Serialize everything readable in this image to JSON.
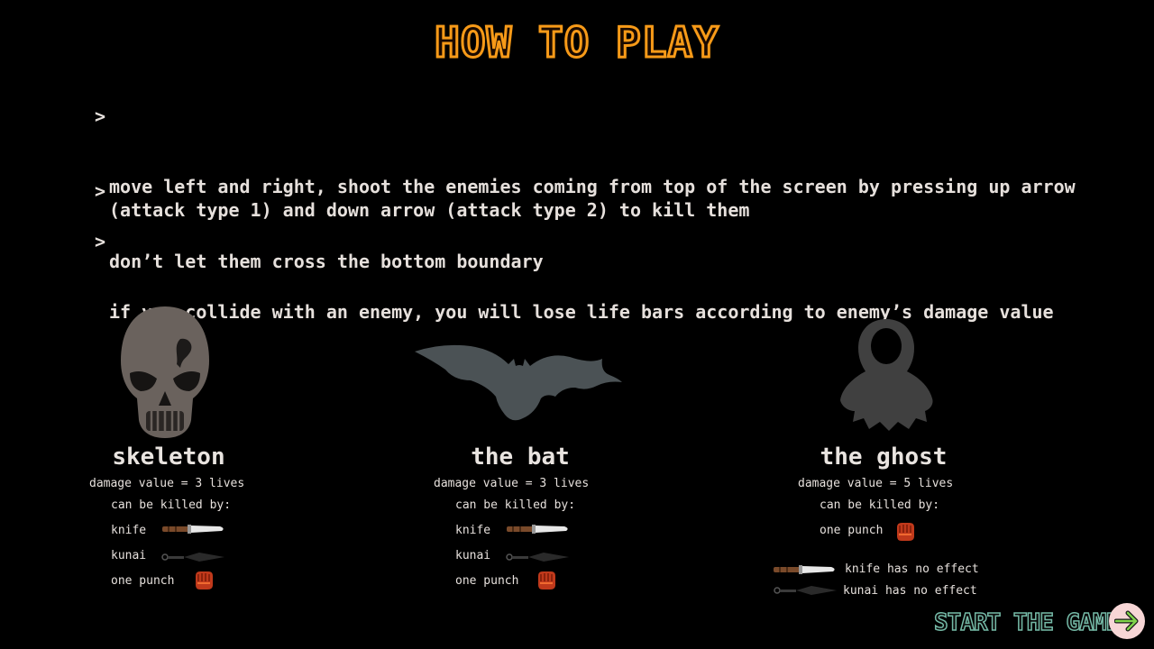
{
  "title": "HOW TO PLAY",
  "rules": [
    {
      "mark": ">",
      "text": "move left and right, shoot the enemies coming from top of the screen by pressing up arrow (attack type 1) and down arrow (attack type 2) to kill them"
    },
    {
      "mark": ">",
      "text": "don’t let them cross the bottom boundary"
    },
    {
      "mark": ">",
      "text": "if you collide with an enemy, you will lose life bars according to enemy’s damage value"
    }
  ],
  "enemies": [
    {
      "name": "skeleton",
      "damage": "damage value = 3 lives",
      "killed_by_label": "can be killed by:",
      "weapons": [
        "knife",
        "kunai",
        "one punch"
      ]
    },
    {
      "name": "the bat",
      "damage": "damage value = 3 lives",
      "killed_by_label": "can be killed by:",
      "weapons": [
        "knife",
        "kunai",
        "one punch"
      ]
    },
    {
      "name": "the ghost",
      "damage": "damage value = 5 lives",
      "killed_by_label": "can be killed by:",
      "weapons": [
        "one punch"
      ],
      "no_effect": [
        "knife has no effect",
        "kunai has no effect"
      ]
    }
  ],
  "start_label": "START THE GAME",
  "icons": {
    "skeleton": "skull-icon",
    "bat": "bat-icon",
    "ghost": "ghost-icon",
    "knife": "knife-icon",
    "kunai": "kunai-icon",
    "punch": "fist-icon",
    "start": "arrow-right-icon"
  },
  "colors": {
    "title_outline": "#f79a18",
    "start_outline": "#74b9a6",
    "start_button": "#f7d6d6",
    "arrow": "#7fd34a"
  }
}
